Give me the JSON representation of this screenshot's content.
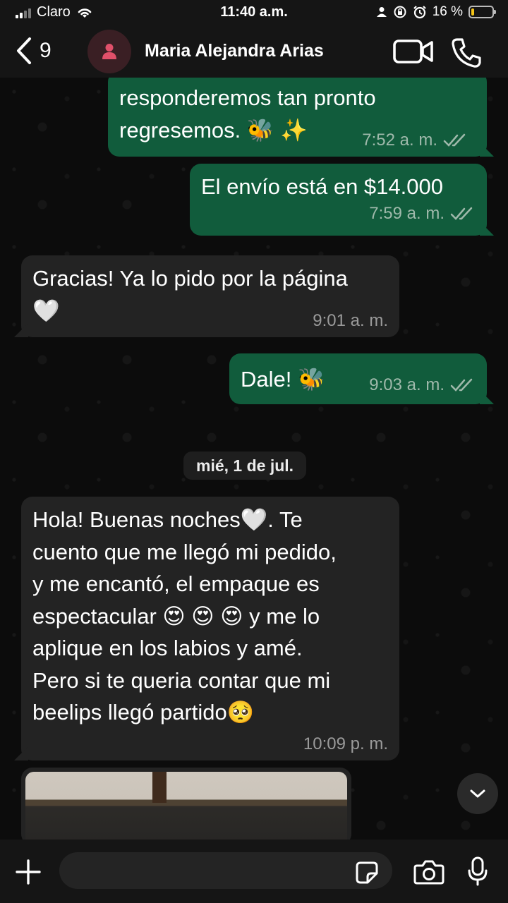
{
  "status_bar": {
    "carrier": "Claro",
    "time": "11:40 a.m.",
    "battery_percent": "16 %",
    "battery_level": 0.16
  },
  "header": {
    "back_count": "9",
    "contact_name": "Maria Alejandra Arias",
    "icons": [
      "back-chevron-icon",
      "person-icon",
      "video-call-icon",
      "phone-icon"
    ]
  },
  "messages": [
    {
      "direction": "outgoing",
      "text": "responderemos tan pronto\nregresemos. 🐝 ✨",
      "time": "7:52 a. m.",
      "status": "read"
    },
    {
      "direction": "outgoing",
      "text": "El envío está en $14.000",
      "time": "7:59 a. m.",
      "status": "read"
    },
    {
      "direction": "incoming",
      "text": "Gracias! Ya lo pido por la página\n🤍",
      "time": "9:01 a. m."
    },
    {
      "direction": "outgoing",
      "text": "Dale! 🐝",
      "time": "9:03 a. m.",
      "status": "read"
    },
    {
      "direction": "incoming",
      "text": "Hola! Buenas noches🤍. Te\ncuento que me llegó mi pedido,\ny me encantó, el empaque es\nespectacular 😍 😍 😍  y me lo\naplique en los labios y amé.\nPero si te queria contar que mi\nbeelips llegó partido🥺",
      "time": "10:09 p. m."
    }
  ],
  "date_separator": "mié, 1 de jul.",
  "composer": {
    "value": "",
    "icons": [
      "plus-icon",
      "sticker-icon",
      "camera-icon",
      "microphone-icon"
    ]
  },
  "colors": {
    "outgoing_bubble": "#115c3c",
    "incoming_bubble": "#232323",
    "background": "#0b0b0b",
    "read_ticks": "#9fb9ab"
  }
}
